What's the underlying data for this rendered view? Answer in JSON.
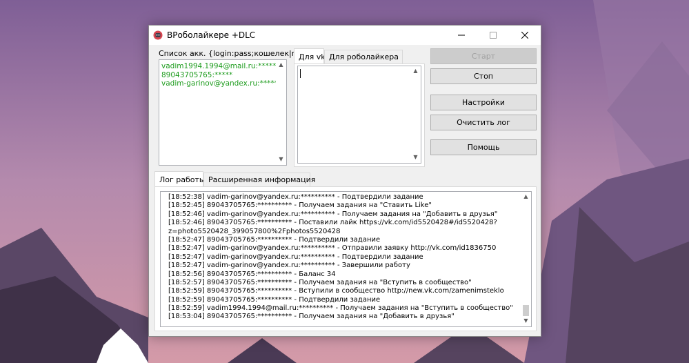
{
  "window": {
    "title": "ВРоболайкере +DLC",
    "minimize_label": "—",
    "maximize_label": "☐",
    "close_label": "✕"
  },
  "accounts": {
    "label": "Список акк. {login:pass;кошелек|mail}",
    "lines": [
      "vadim1994.1994@mail.ru:******",
      "89043705765:*****",
      "vadim-garinov@yandex.ru:*****"
    ]
  },
  "input_tabs": [
    {
      "label": "Для vk",
      "active": true
    },
    {
      "label": "Для роболайкера",
      "active": false
    }
  ],
  "buttons": {
    "start": "Старт",
    "stop": "Стоп",
    "settings": "Настройки",
    "clear_log": "Очистить лог",
    "help": "Помощь"
  },
  "log_tabs": [
    {
      "label": "Лог работы",
      "active": true
    },
    {
      "label": "Расширенная информация",
      "active": false
    }
  ],
  "log": [
    "[18:52:38] vadim-garinov@yandex.ru:********** - Подтвердили задание",
    "[18:52:45] 89043705765:********** - Получаем задания на \"Ставить Like\"",
    "[18:52:46] vadim-garinov@yandex.ru:********** - Получаем задания на \"Добавить в друзья\"",
    "[18:52:46] 89043705765:********** - Поставили лайк https://vk.com/id5520428#/id5520428?",
    "z=photo5520428_399057800%2Fphotos5520428",
    "[18:52:47] 89043705765:********** - Подтвердили задание",
    "[18:52:47] vadim-garinov@yandex.ru:********** - Отправили заявку http://vk.com/id1836750",
    "[18:52:47] vadim-garinov@yandex.ru:********** - Подтвердили задание",
    "[18:52:47] vadim-garinov@yandex.ru:********** - Завершили работу",
    "[18:52:56] 89043705765:********** - Баланс 34",
    "[18:52:57] 89043705765:********** - Получаем задания на \"Вступить в сообщество\"",
    "[18:52:59] 89043705765:********** - Вступили в сообщество http://new.vk.com/zamenimsteklo",
    "[18:52:59] 89043705765:********** - Подтвердили задание",
    "[18:52:59] vadim1994.1994@mail.ru:********** - Получаем задания на \"Вступить в сообщество\"",
    "[18:53:04] 89043705765:********** - Получаем задания на \"Добавить в друзья\""
  ],
  "icons": {
    "app": "robot-avatar-icon",
    "scroll_up": "chevron-up-icon",
    "scroll_down": "chevron-down-icon"
  },
  "colors": {
    "account_text": "#1e9c1e",
    "app_icon": "#d64550"
  }
}
